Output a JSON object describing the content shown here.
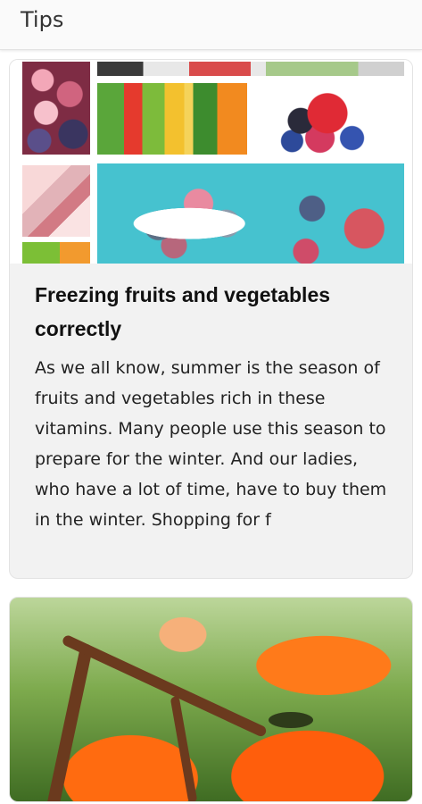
{
  "app_bar": {
    "title": "Tips"
  },
  "feed": {
    "cards": [
      {
        "image_subject": "frozen fruits and vegetables collage",
        "title": "Freezing fruits and vegetables correctly",
        "excerpt": "As we all know, summer is the season of fruits and vegetables rich in these vitamins. Many people use this season to prepare for the winter. And our ladies, who have a lot of time, have to buy them in the winter. Shopping for f"
      },
      {
        "image_subject": "persimmons on a branch"
      }
    ]
  },
  "colors": {
    "app_bar_bg": "#fafafa",
    "card_bg": "#f2f2f2",
    "text": "#111111"
  }
}
